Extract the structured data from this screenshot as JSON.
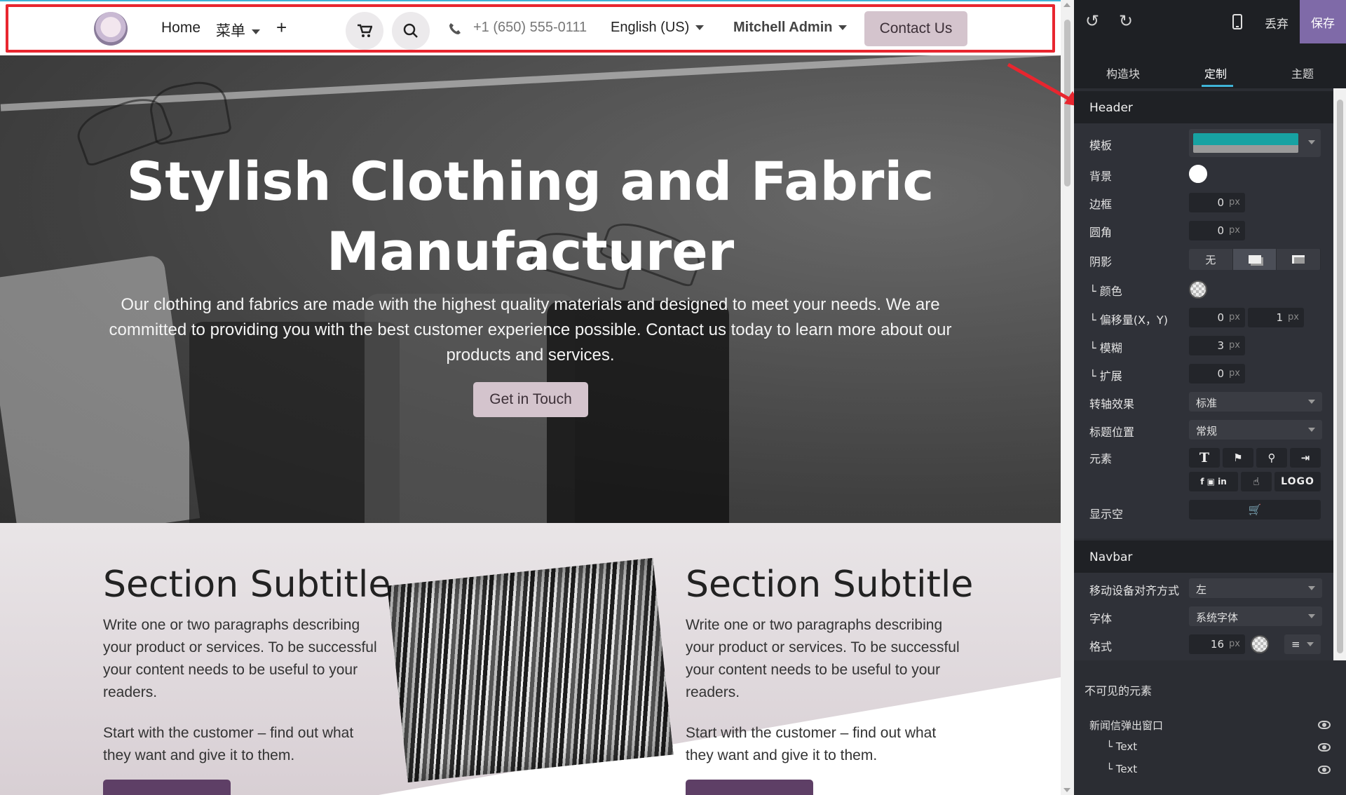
{
  "header": {
    "nav": {
      "home": "Home",
      "menu": "菜单",
      "add": "+",
      "phone": "+1 (650) 555-0111",
      "language": "English (US)",
      "user": "Mitchell Admin",
      "contact": "Contact Us"
    }
  },
  "hero": {
    "title": "Stylish Clothing and Fabric Manufacturer",
    "text": "Our clothing and fabrics are made with the highest quality materials and designed to meet your needs. We are committed to providing you with the best customer experience possible. Contact us today to learn more about our products and services.",
    "button": "Get in Touch"
  },
  "content": {
    "left": {
      "title": "Section Subtitle",
      "p1": "Write one or two paragraphs describing your product or services. To be successful your content needs to be useful to your readers.",
      "p2": "Start with the customer – find out what they want and give it to them."
    },
    "right": {
      "title": "Section Subtitle",
      "p1": "Write one or two paragraphs describing your product or services. To be successful your content needs to be useful to your readers.",
      "p2": "Start with the customer – find out what they want and give it to them."
    }
  },
  "editor": {
    "top": {
      "discard": "丢弃",
      "save": "保存"
    },
    "tabs": {
      "blocks": "构造块",
      "customize": "定制",
      "theme": "主题"
    },
    "header_section": {
      "title": "Header",
      "template": "模板",
      "background": "背景",
      "border": "边框",
      "border_value": "0",
      "radius": "圆角",
      "radius_value": "0",
      "shadow": "阴影",
      "shadow_none": "无",
      "shadow_color": "└ 颜色",
      "shadow_offset": "└ 偏移量(X，Y)",
      "offset_x": "0",
      "offset_y": "1",
      "shadow_blur": "└ 模糊",
      "blur_value": "3",
      "shadow_spread": "└ 扩展",
      "spread_value": "0",
      "effect": "转轴效果",
      "effect_value": "标准",
      "title_position": "标题位置",
      "title_position_value": "常规",
      "elements": "元素",
      "elements_logo": "LOGO",
      "show_empty": "显示空",
      "unit": "px"
    },
    "navbar_section": {
      "title": "Navbar",
      "mobile_align": "移动设备对齐方式",
      "mobile_align_value": "左",
      "font": "字体",
      "font_value": "系统字体",
      "format": "格式",
      "format_value": "16",
      "unit": "px"
    },
    "invisible": {
      "title": "不可见的元素",
      "items": [
        "新闻信弹出窗口",
        "└ Text",
        "└ Text"
      ]
    }
  },
  "colors": {
    "accent_button": "#d4c4cd",
    "save_button": "#7f6aa8",
    "highlight": "#e8262f",
    "cta_purple": "#5e3f66"
  }
}
